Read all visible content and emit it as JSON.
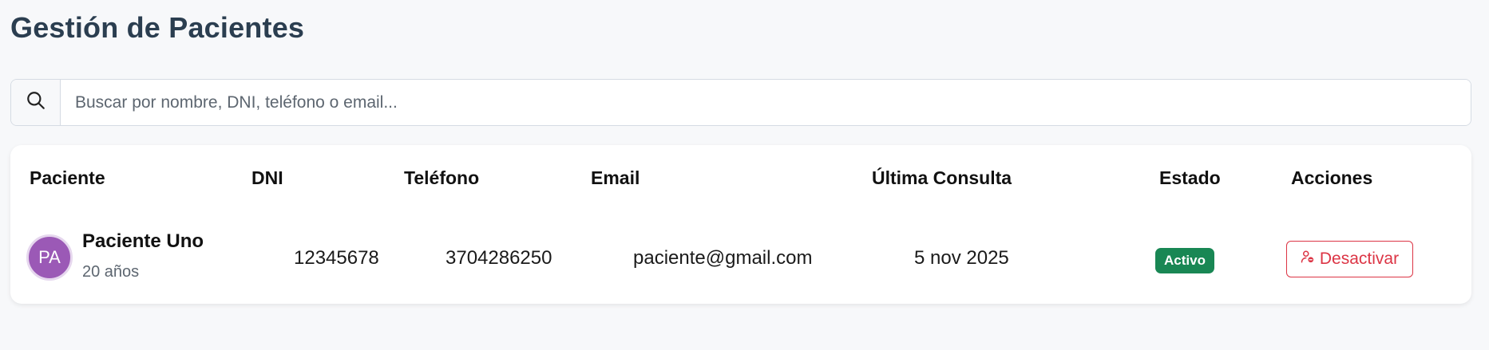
{
  "page": {
    "title": "Gestión de Pacientes"
  },
  "search": {
    "icon": "search-icon",
    "placeholder": "Buscar por nombre, DNI, teléfono o email..."
  },
  "table": {
    "headers": [
      "Paciente",
      "DNI",
      "Teléfono",
      "Email",
      "Última Consulta",
      "Estado",
      "Acciones"
    ],
    "rows": [
      {
        "avatar_initials": "PA",
        "avatar_color": "#9b59b6",
        "name": "Paciente Uno",
        "age": "20 años",
        "dni": "12345678",
        "phone": "3704286250",
        "email": "paciente@gmail.com",
        "last_visit": "5 nov 2025",
        "status": "Activo",
        "status_color": "#198754",
        "action_label": "Desactivar",
        "action_icon": "user-remove-icon",
        "action_color": "#dc3545"
      }
    ]
  }
}
